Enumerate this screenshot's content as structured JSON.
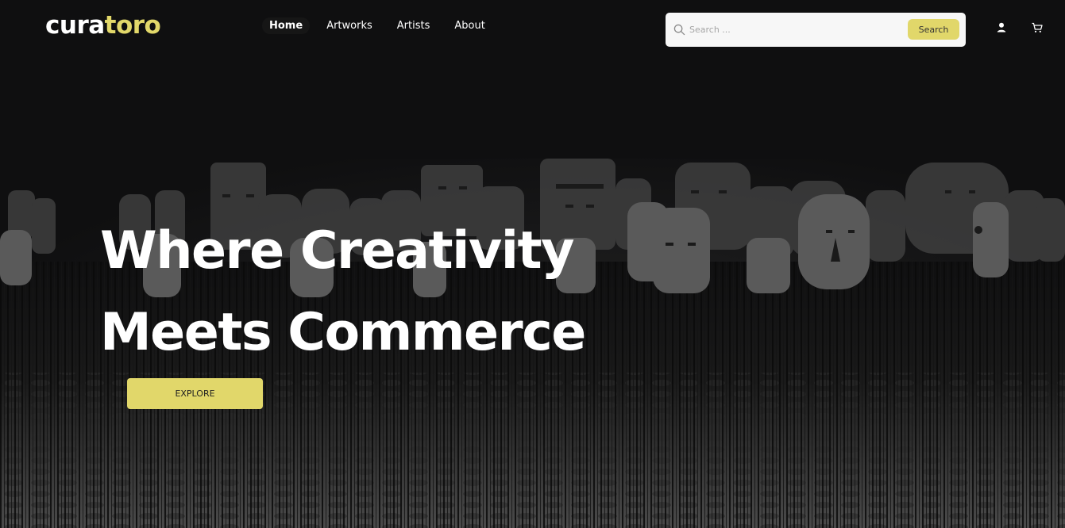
{
  "logo": {
    "part1": "cura",
    "part2": "toro"
  },
  "nav": {
    "items": [
      {
        "label": "Home",
        "active": true
      },
      {
        "label": "Artworks",
        "active": false
      },
      {
        "label": "Artists",
        "active": false
      },
      {
        "label": "About",
        "active": false
      }
    ]
  },
  "search": {
    "placeholder": "Search ...",
    "value": "",
    "button_label": "Search"
  },
  "icons": {
    "search": "search-icon",
    "user": "user-icon",
    "cart": "cart-icon"
  },
  "hero": {
    "line1": "Where Creativity",
    "line2": "Meets Commerce",
    "cta_label": "EXPLORE",
    "image": "masks-on-poles-background"
  },
  "colors": {
    "accent": "#e1d76a",
    "background": "#0f0f10",
    "text": "#ffffff"
  }
}
